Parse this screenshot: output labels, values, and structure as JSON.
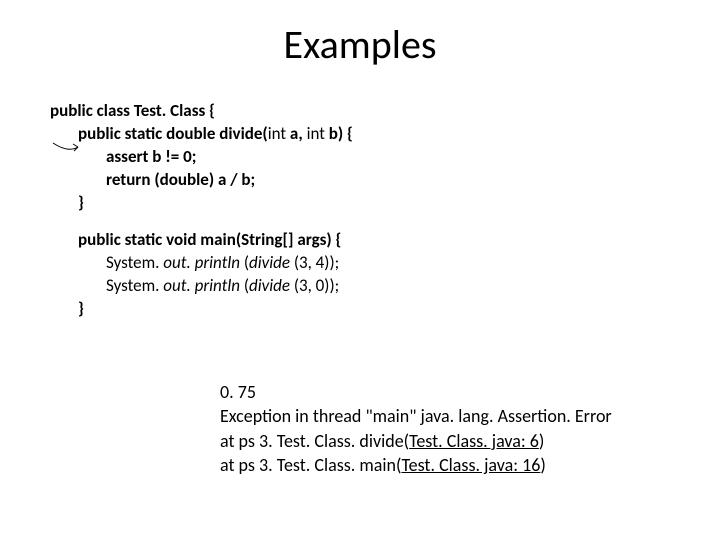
{
  "title": "Examples",
  "code": {
    "l1": "public class Test. Class {",
    "l2_a": "public static double divide(",
    "l2_b": "int",
    "l2_c": " a, ",
    "l2_d": "int",
    "l2_e": " b) {",
    "l3": "assert b != 0;",
    "l4": "return (double) a / b;",
    "l5": "}",
    "l6": "public static void main(String[] args) {",
    "l7_a": "System. ",
    "l7_b": "out. println",
    "l7_c": " (",
    "l7_d": "divide ",
    "l7_e": "(3, 4));",
    "l8_a": "System. ",
    "l8_b": "out. println",
    "l8_c": " (",
    "l8_d": "divide ",
    "l8_e": "(3, 0));",
    "l9": "}"
  },
  "output": {
    "o1": "0. 75",
    "o2": "Exception in thread \"main\" java. lang. Assertion. Error",
    "o3_a": "at ps 3. Test. Class. divide(",
    "o3_b": "Test. Class. java: 6",
    "o3_c": ")",
    "o4_a": "at ps 3. Test. Class. main(",
    "o4_b": "Test. Class. java: 16",
    "o4_c": ")"
  }
}
